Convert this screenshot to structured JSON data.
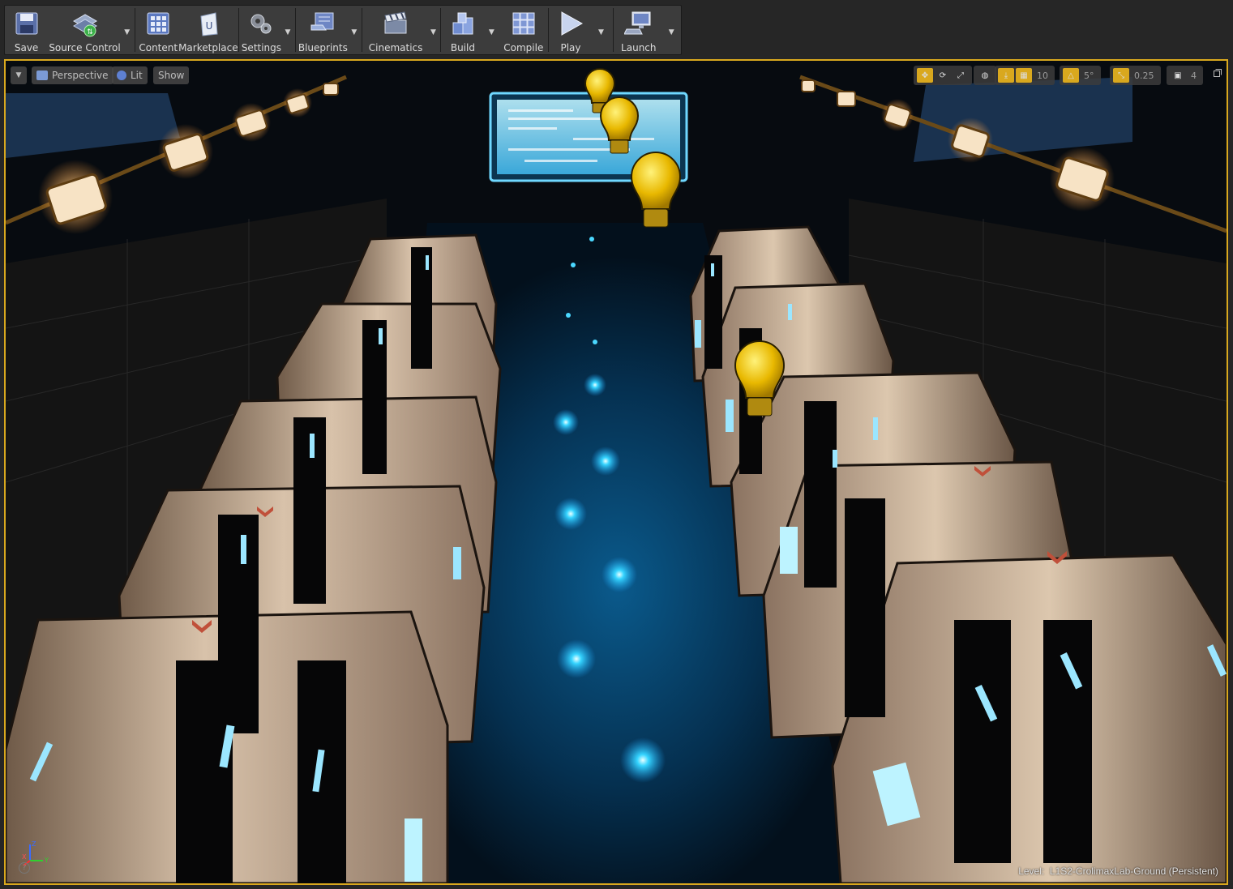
{
  "toolbar": {
    "buttons": [
      {
        "id": "save",
        "label": "Save",
        "icon": "save-icon"
      },
      {
        "id": "source",
        "label": "Source Control",
        "icon": "source-control-icon"
      },
      {
        "id": "content",
        "label": "Content",
        "icon": "content-browser-icon"
      },
      {
        "id": "marketplace",
        "label": "Marketplace",
        "icon": "marketplace-icon"
      },
      {
        "id": "settings",
        "label": "Settings",
        "icon": "settings-icon"
      },
      {
        "id": "blueprints",
        "label": "Blueprints",
        "icon": "blueprints-icon"
      },
      {
        "id": "cinematics",
        "label": "Cinematics",
        "icon": "cinematics-icon"
      },
      {
        "id": "build",
        "label": "Build",
        "icon": "build-icon"
      },
      {
        "id": "compile",
        "label": "Compile",
        "icon": "compile-icon"
      },
      {
        "id": "play",
        "label": "Play",
        "icon": "play-icon"
      },
      {
        "id": "launch",
        "label": "Launch",
        "icon": "launch-icon"
      }
    ]
  },
  "viewport": {
    "view_mode": "Perspective",
    "lighting_mode": "Lit",
    "show_label": "Show",
    "grid_snap_value": "10",
    "rotation_snap_value": "5°",
    "scale_snap_value": "0.25",
    "camera_speed_value": "4",
    "level_prefix": "Level:",
    "level_name": "L1S2-CrolimaxLab-Ground (Persistent)",
    "axis_labels": [
      "Z",
      "X",
      "Y"
    ],
    "help_glyph": "?"
  },
  "colors": {
    "accent_border": "#d9a81e",
    "toolbar_bg": "#3c3c3c",
    "light_bulb": "#e8b800",
    "floor_glow": "#19c8ff"
  }
}
